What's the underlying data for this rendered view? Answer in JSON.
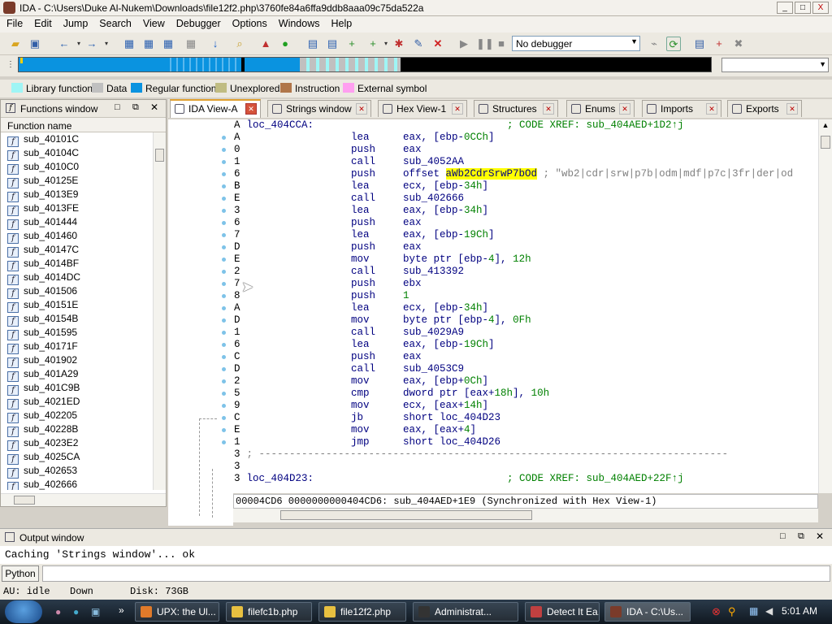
{
  "window": {
    "title": "IDA - C:\\Users\\Duke Al-Nukem\\Downloads\\file12f2.php\\3760fe84a6ffa9ddb8aaa09c75da522a",
    "min": "_",
    "max": "□",
    "close": "X"
  },
  "menu": [
    "File",
    "Edit",
    "Jump",
    "Search",
    "View",
    "Debugger",
    "Options",
    "Windows",
    "Help"
  ],
  "toolbar": {
    "debugger": "No debugger"
  },
  "legend": [
    {
      "label": "Library function",
      "color": "#9ff5f5"
    },
    {
      "label": "Data",
      "color": "#c0c0c0"
    },
    {
      "label": "Regular function",
      "color": "#0a93e0"
    },
    {
      "label": "Unexplored",
      "color": "#c0bc82"
    },
    {
      "label": "Instruction",
      "color": "#b0764a"
    },
    {
      "label": "External symbol",
      "color": "#ff9ff0"
    }
  ],
  "functions": {
    "title": "Functions window",
    "column": "Function name",
    "items": [
      "sub_40101C",
      "sub_40104C",
      "sub_4010C0",
      "sub_40125E",
      "sub_4013E9",
      "sub_4013FE",
      "sub_401444",
      "sub_401460",
      "sub_40147C",
      "sub_4014BF",
      "sub_4014DC",
      "sub_401506",
      "sub_40151E",
      "sub_40154B",
      "sub_401595",
      "sub_40171F",
      "sub_401902",
      "sub_401A29",
      "sub_401C9B",
      "sub_4021ED",
      "sub_402205",
      "sub_40228B",
      "sub_4023E2",
      "sub_4025CA",
      "sub_402653",
      "sub_402666"
    ]
  },
  "tabs": [
    "IDA View-A",
    "Strings window",
    "Hex View-1",
    "Structures",
    "Enums",
    "Imports",
    "Exports"
  ],
  "code": [
    {
      "a": "A",
      "lbl": "loc_404CCA:",
      "cmt": "; CODE XREF: sub_404AED+1D2↑j"
    },
    {
      "a": "A",
      "op": "lea",
      "args": [
        [
          "eax, [ebp-",
          ""
        ],
        [
          "0CCh",
          "n"
        ],
        [
          "]",
          ""
        ]
      ]
    },
    {
      "a": "0",
      "op": "push",
      "args": [
        [
          "eax",
          ""
        ]
      ]
    },
    {
      "a": "1",
      "op": "call",
      "args": [
        [
          "sub_4052AA",
          ""
        ]
      ]
    },
    {
      "a": "6",
      "op": "push",
      "args": [
        [
          "offset ",
          ""
        ],
        [
          "aWb2CdrSrwP7bOd",
          "hl"
        ],
        [
          " ; \"wb2|cdr|srw|p7b|odm|mdf|p7c|3fr|der|od",
          "cm"
        ]
      ]
    },
    {
      "a": "B",
      "op": "lea",
      "args": [
        [
          "ecx, [ebp-",
          ""
        ],
        [
          "34h",
          "n"
        ],
        [
          "]",
          ""
        ]
      ]
    },
    {
      "a": "E",
      "op": "call",
      "args": [
        [
          "sub_402666",
          ""
        ]
      ]
    },
    {
      "a": "3",
      "op": "lea",
      "args": [
        [
          "eax, [ebp-",
          ""
        ],
        [
          "34h",
          "n"
        ],
        [
          "]",
          ""
        ]
      ]
    },
    {
      "a": "6",
      "op": "push",
      "args": [
        [
          "eax",
          ""
        ]
      ]
    },
    {
      "a": "7",
      "op": "lea",
      "args": [
        [
          "eax, [ebp-",
          ""
        ],
        [
          "19Ch",
          "n"
        ],
        [
          "]",
          ""
        ]
      ]
    },
    {
      "a": "D",
      "op": "push",
      "args": [
        [
          "eax",
          ""
        ]
      ]
    },
    {
      "a": "E",
      "op": "mov",
      "args": [
        [
          "byte ptr [ebp-",
          ""
        ],
        [
          "4",
          "n"
        ],
        [
          "], ",
          ""
        ],
        [
          "12h",
          "n"
        ]
      ]
    },
    {
      "a": "2",
      "op": "call",
      "args": [
        [
          "sub_413392",
          ""
        ]
      ]
    },
    {
      "a": "7",
      "op": "push",
      "args": [
        [
          "ebx",
          ""
        ]
      ]
    },
    {
      "a": "8",
      "op": "push",
      "args": [
        [
          "1",
          "n"
        ]
      ]
    },
    {
      "a": "A",
      "op": "lea",
      "args": [
        [
          "ecx, [ebp-",
          ""
        ],
        [
          "34h",
          "n"
        ],
        [
          "]",
          ""
        ]
      ]
    },
    {
      "a": "D",
      "op": "mov",
      "args": [
        [
          "byte ptr [ebp-",
          ""
        ],
        [
          "4",
          "n"
        ],
        [
          "], ",
          ""
        ],
        [
          "0Fh",
          "n"
        ]
      ]
    },
    {
      "a": "1",
      "op": "call",
      "args": [
        [
          "sub_4029A9",
          ""
        ]
      ]
    },
    {
      "a": "6",
      "op": "lea",
      "args": [
        [
          "eax, [ebp-",
          ""
        ],
        [
          "19Ch",
          "n"
        ],
        [
          "]",
          ""
        ]
      ]
    },
    {
      "a": "C",
      "op": "push",
      "args": [
        [
          "eax",
          ""
        ]
      ]
    },
    {
      "a": "D",
      "op": "call",
      "args": [
        [
          "sub_4053C9",
          ""
        ]
      ]
    },
    {
      "a": "2",
      "op": "mov",
      "args": [
        [
          "eax, [ebp+",
          ""
        ],
        [
          "0Ch",
          "n"
        ],
        [
          "]",
          ""
        ]
      ]
    },
    {
      "a": "5",
      "op": "cmp",
      "args": [
        [
          "dword ptr [eax+",
          ""
        ],
        [
          "18h",
          "n"
        ],
        [
          "], ",
          ""
        ],
        [
          "10h",
          "n"
        ]
      ]
    },
    {
      "a": "9",
      "op": "mov",
      "args": [
        [
          "ecx, [eax+",
          ""
        ],
        [
          "14h",
          "n"
        ],
        [
          "]",
          ""
        ]
      ]
    },
    {
      "a": "C",
      "op": "jb",
      "args": [
        [
          "short loc_404D23",
          ""
        ]
      ]
    },
    {
      "a": "E",
      "op": "mov",
      "args": [
        [
          "eax, [eax+",
          ""
        ],
        [
          "4",
          "n"
        ],
        [
          "]",
          ""
        ]
      ]
    },
    {
      "a": "1",
      "op": "jmp",
      "args": [
        [
          "short loc_404D26",
          ""
        ]
      ]
    },
    {
      "a": "3",
      "raw": "; -----------------------------------------------------------------------------"
    },
    {
      "a": "3",
      "raw": ""
    },
    {
      "a": "3",
      "lbl": "loc_404D23:",
      "cmt": "; CODE XREF: sub_404AED+22F↑j"
    }
  ],
  "status_line": "00004CD6 0000000000404CD6: sub_404AED+1E9 (Synchronized with Hex View-1)",
  "output": {
    "title": "Output window",
    "text": "Caching 'Strings window'... ok",
    "python": "Python"
  },
  "status": {
    "au": "AU:  idle",
    "dir": "Down",
    "disk": "Disk: 73GB"
  },
  "taskbar": {
    "items": [
      {
        "label": "UPX: the Ul...",
        "color": "#e07a2a"
      },
      {
        "label": "filefc1b.php",
        "color": "#e8c040"
      },
      {
        "label": "file12f2.php",
        "color": "#e8c040"
      },
      {
        "label": "Administrat...",
        "color": "#333333"
      },
      {
        "label": "Detect It Ea...",
        "color": "#c04040"
      },
      {
        "label": "IDA - C:\\Us...",
        "color": "#7a3b2a"
      }
    ],
    "clock": "5:01 AM"
  }
}
